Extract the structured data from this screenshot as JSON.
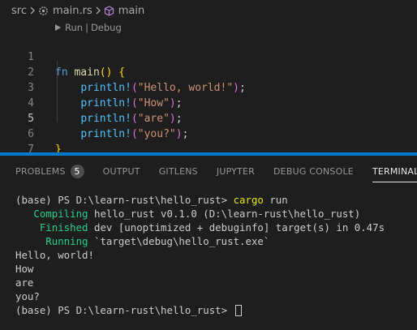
{
  "breadcrumb": {
    "folder": "src",
    "file": "main.rs",
    "symbol": "main"
  },
  "editor": {
    "codelens": {
      "run": "Run",
      "separator": "|",
      "debug": "Debug"
    },
    "active_line": 5,
    "lines": [
      {
        "number": "1",
        "text": "fn main() {"
      },
      {
        "number": "2",
        "text": "    println!(\"Hello, world!\");"
      },
      {
        "number": "3",
        "text": "    println!(\"How\");"
      },
      {
        "number": "4",
        "text": "    println!(\"are\");"
      },
      {
        "number": "5",
        "text": "    println!(\"you?\");"
      },
      {
        "number": "6",
        "text": "}"
      },
      {
        "number": "7",
        "text": ""
      }
    ],
    "tokens": {
      "l1": {
        "kw": "fn",
        "name": "main",
        "parens": "()",
        "brace": "{"
      },
      "l2": {
        "macro": "println!",
        "open": "(",
        "str": "\"Hello, world!\"",
        "close": ")",
        "semi": ";"
      },
      "l3": {
        "macro": "println!",
        "open": "(",
        "str": "\"How\"",
        "close": ")",
        "semi": ";"
      },
      "l4": {
        "macro": "println!",
        "open": "(",
        "str": "\"are\"",
        "close": ")",
        "semi": ";"
      },
      "l5": {
        "macro": "println!",
        "open": "(",
        "str": "\"you?\"",
        "close": ")",
        "semi": ";"
      },
      "l6": {
        "brace": "}"
      }
    }
  },
  "panel": {
    "tabs": [
      {
        "label": "PROBLEMS",
        "badge": "5"
      },
      {
        "label": "OUTPUT"
      },
      {
        "label": "GITLENS"
      },
      {
        "label": "JUPYTER"
      },
      {
        "label": "DEBUG CONSOLE"
      },
      {
        "label": "TERMINAL"
      }
    ],
    "active_tab": "TERMINAL"
  },
  "terminal": {
    "prompt1": "(base) PS D:\\learn-rust\\hello_rust> ",
    "command": "cargo",
    "command_arg": " run",
    "compiling_label": "   Compiling",
    "compiling_text": " hello_rust v0.1.0 (D:\\learn-rust\\hello_rust)",
    "finished_label": "    Finished",
    "finished_text": " dev [unoptimized + debuginfo] target(s) in 0.47s",
    "running_label": "     Running",
    "running_text": " `target\\debug\\hello_rust.exe`",
    "output": [
      "Hello, world!",
      "How",
      "are",
      "you?"
    ],
    "prompt2": "(base) PS D:\\learn-rust\\hello_rust> "
  },
  "colors": {
    "background": "#1e1e1e",
    "accent": "#007acc",
    "terminal_green": "#23d18b",
    "terminal_yellow": "#e5e510"
  }
}
